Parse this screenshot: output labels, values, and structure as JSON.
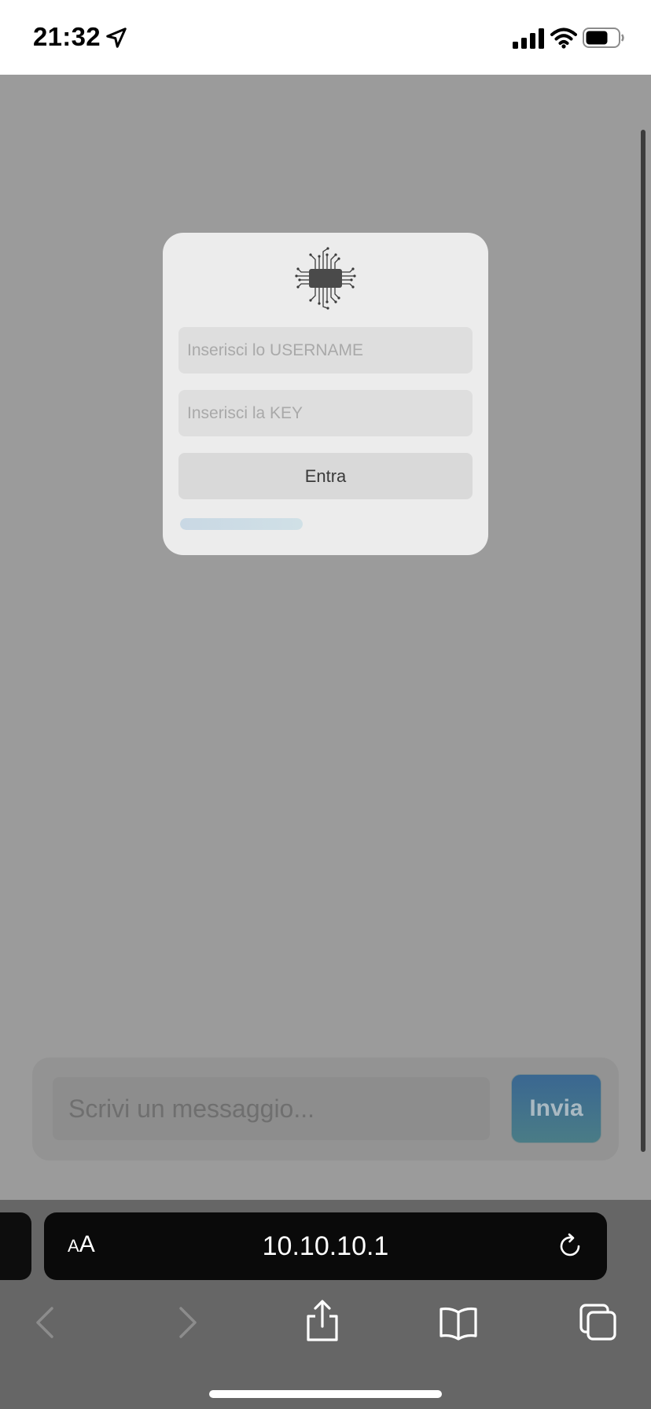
{
  "status_bar": {
    "time": "21:32",
    "icons": [
      "location-icon",
      "signal-icon",
      "wifi-icon",
      "battery-icon"
    ]
  },
  "login": {
    "logo_icon": "chip-icon",
    "username_placeholder": "Inserisci lo USERNAME",
    "username_value": "",
    "key_placeholder": "Inserisci la KEY",
    "key_value": "",
    "enter_label": "Entra",
    "progress_fraction": 0.6
  },
  "chat": {
    "message_placeholder": "Scrivi un messaggio...",
    "message_value": "",
    "send_label": "Invia"
  },
  "browser": {
    "aa_small": "A",
    "aa_large": "A",
    "url": "10.10.10.1",
    "icons": [
      "reload-icon",
      "back-icon",
      "forward-icon",
      "share-icon",
      "bookmarks-icon",
      "tabs-icon"
    ]
  },
  "colors": {
    "page_background": "#9b9b9b",
    "card_background": "#ececec",
    "send_button_top": "#3a6791",
    "send_button_bottom": "#4a7c86",
    "toolbar_background": "#666666",
    "address_bar": "#0a0a0a"
  }
}
